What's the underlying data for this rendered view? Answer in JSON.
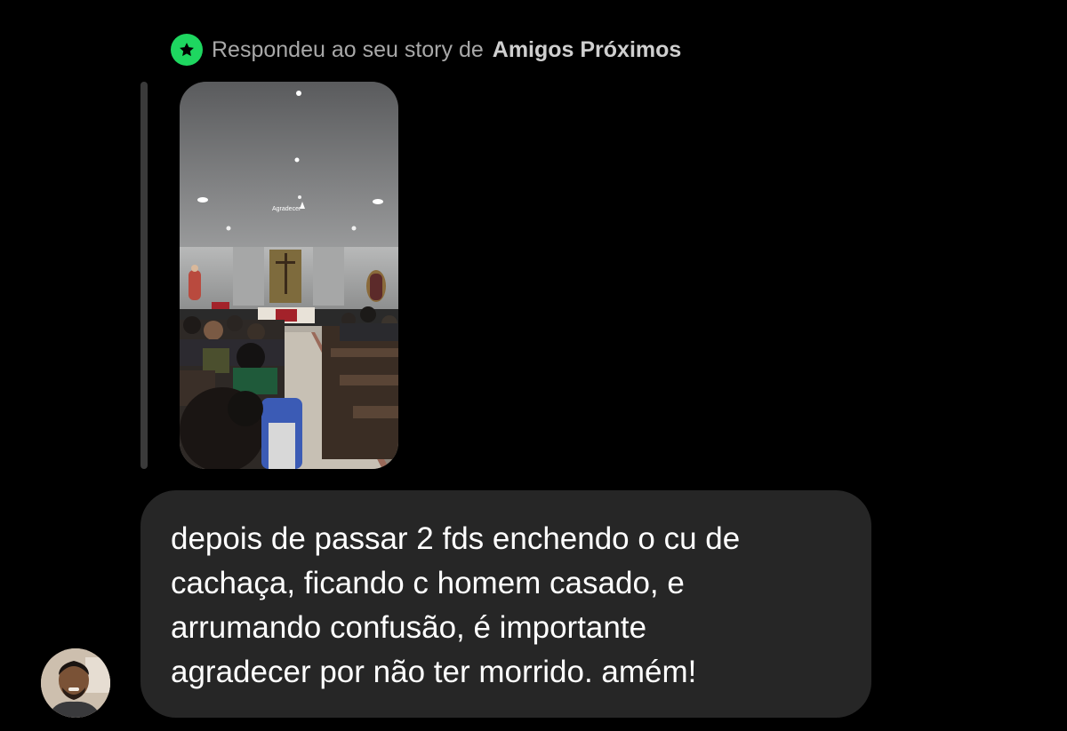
{
  "reply_header": {
    "prefix": "Respondeu ao seu story de",
    "list_name": "Amigos Próximos",
    "badge_icon": "star-icon",
    "badge_color": "#1ed760"
  },
  "story_preview": {
    "overlay_text": "Agradecer"
  },
  "message": {
    "text": "depois de passar 2 fds enchendo o cu de\ncachaça, ficando c homem casado, e\narrumando confusão, é importante\nagradecer por não ter morrido. amém!",
    "bubble_color": "#262626"
  },
  "sender": {
    "avatar_icon": "user-avatar"
  }
}
